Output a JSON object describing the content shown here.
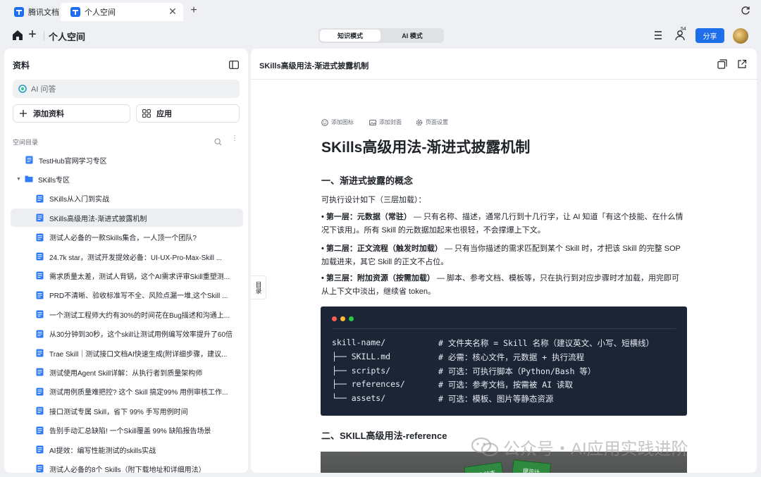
{
  "browser": {
    "tabs": [
      {
        "label": "腾讯文档",
        "active": false
      },
      {
        "label": "个人空间",
        "active": true
      }
    ]
  },
  "header": {
    "space_title": "个人空间",
    "modes": [
      "知识模式",
      "AI 模式"
    ],
    "active_mode": "知识模式",
    "notification_count": "54",
    "share_label": "分享"
  },
  "sidebar": {
    "title": "资料",
    "ai_placeholder": "AI 问答",
    "add_label": "添加资料",
    "apps_label": "应用",
    "dir_label": "空间目录",
    "items": [
      {
        "label": "TestHub官网学习专区",
        "type": "doc",
        "indent": 0
      },
      {
        "label": "SKills专区",
        "type": "folder",
        "indent": 0,
        "expanded": true
      },
      {
        "label": "SKills从入门到实战",
        "type": "doc",
        "indent": 1
      },
      {
        "label": "SKills高级用法-渐进式披露机制",
        "type": "doc",
        "indent": 1,
        "selected": true
      },
      {
        "label": "测试人必备的一款Skills集合，一人顶一个团队?",
        "type": "doc",
        "indent": 1
      },
      {
        "label": "24.7k star，测试开发提效必备：UI-UX-Pro-Max-Skill ...",
        "type": "doc",
        "indent": 1
      },
      {
        "label": "需求质量太差，测试人背锅，这个AI需求评审Skill重塑测...",
        "type": "doc",
        "indent": 1
      },
      {
        "label": "PRD不清晰、验收标准写不全、风险点漏一堆,这个Skill ...",
        "type": "doc",
        "indent": 1
      },
      {
        "label": "一个测试工程师大约有30%的时间花在Bug描述和沟通上...",
        "type": "doc",
        "indent": 1
      },
      {
        "label": "从30分钟到30秒，这个skill让测试用例编写效率提升了60倍",
        "type": "doc",
        "indent": 1
      },
      {
        "label": "Trae Skill｜测试接口文档AI快速生成(附详细步骤，建议...",
        "type": "doc",
        "indent": 1
      },
      {
        "label": "测试使用Agent Skill详解：从执行者到质量架构师",
        "type": "doc",
        "indent": 1
      },
      {
        "label": "测试用例质量难把控? 这个 Skill 搞定99% 用例审核工作...",
        "type": "doc",
        "indent": 1
      },
      {
        "label": "接口测试专属 Skill，省下 99% 手写用例时间",
        "type": "doc",
        "indent": 1
      },
      {
        "label": "告别手动汇总缺陷! 一个Skill覆盖 99% 缺陷报告场景",
        "type": "doc",
        "indent": 1
      },
      {
        "label": "AI提效：编写性能测试的skills实战",
        "type": "doc",
        "indent": 1
      },
      {
        "label": "测试人必备的8个 Skills（附下载地址和详细用法）",
        "type": "doc",
        "indent": 1
      }
    ]
  },
  "document": {
    "header_title": "SKills高级用法-渐进式披露机制",
    "outline_label": "目录",
    "meta": [
      "添加图标",
      "添加封面",
      "页面设置"
    ],
    "title": "SKills高级用法-渐进式披露机制",
    "section1": "一、渐进式披露的概念",
    "intro": "可执行设计如下（三层加载）：",
    "layers": [
      {
        "label": "• 第一层：元数据（常驻）",
        "text": " — 只有名称、描述，通常几行到十几行字，让 AI 知道「有这个技能、在什么情况下该用」。所有 Skill 的元数据加起来也很轻，不会撑爆上下文。"
      },
      {
        "label": "• 第二层：正文流程（触发时加载）",
        "text": " — 只有当你描述的需求匹配到某个 Skill 时，才把该 Skill 的完整 SOP 加载进来，其它 Skill 的正文不占位。"
      },
      {
        "label": "• 第三层：附加资源（按需加载）",
        "text": " — 脚本、参考文档、模板等，只在执行到对应步骤时才加载，用完即可从上下文中淡出，继续省 token。"
      }
    ],
    "code_lines": [
      {
        "code": "skill-name/",
        "comment": "# 文件夹名称 = Skill 名称（建议英文、小写、短横线）"
      },
      {
        "code": "├── SKILL.md",
        "comment": "# 必需：核心文件，元数据 + 执行流程"
      },
      {
        "code": "├── scripts/",
        "comment": "# 可选：可执行脚本（Python/Bash 等）"
      },
      {
        "code": "├── references/",
        "comment": "# 可选：参考文档，按需被 AI 读取"
      },
      {
        "code": "└── assets/",
        "comment": "# 可选：模板、图片等静态资源"
      }
    ],
    "section2": "二、SKILL高级用法-reference",
    "photo_cards": [
      "待办状态",
      "提示计"
    ]
  },
  "watermark": "公众号・AI应用实践进阶",
  "colors": {
    "accent": "#1f6feb",
    "code_bg": "#1c2536",
    "dot_red": "#ff5f57",
    "dot_yellow": "#febc2e",
    "dot_green": "#28c840"
  }
}
